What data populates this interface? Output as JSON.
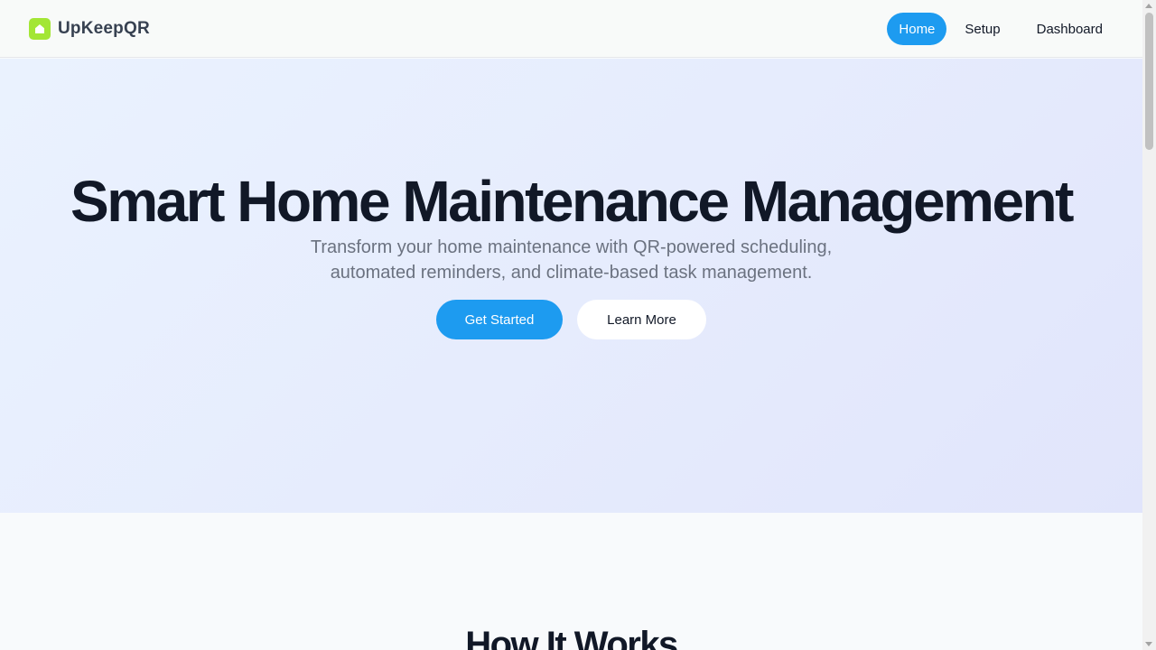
{
  "navbar": {
    "brand": {
      "name": "UpKeepQR",
      "icon": "home-icon",
      "logo_color": "#a3e635"
    },
    "links": [
      {
        "label": "Home",
        "active": true
      },
      {
        "label": "Setup",
        "active": false
      },
      {
        "label": "Dashboard",
        "active": false
      }
    ]
  },
  "hero": {
    "title": "Smart Home Maintenance Management",
    "subtitle_line1": "Transform your home maintenance with QR-powered scheduling,",
    "subtitle_line2": "automated reminders, and climate-based task management.",
    "primary_button": "Get Started",
    "secondary_button": "Learn More"
  },
  "how_it_works": {
    "title": "How It Works"
  },
  "colors": {
    "accent": "#1d9bf0",
    "brand_logo": "#a3e635",
    "title_text": "#111827",
    "subtitle_text": "#6b7280"
  }
}
